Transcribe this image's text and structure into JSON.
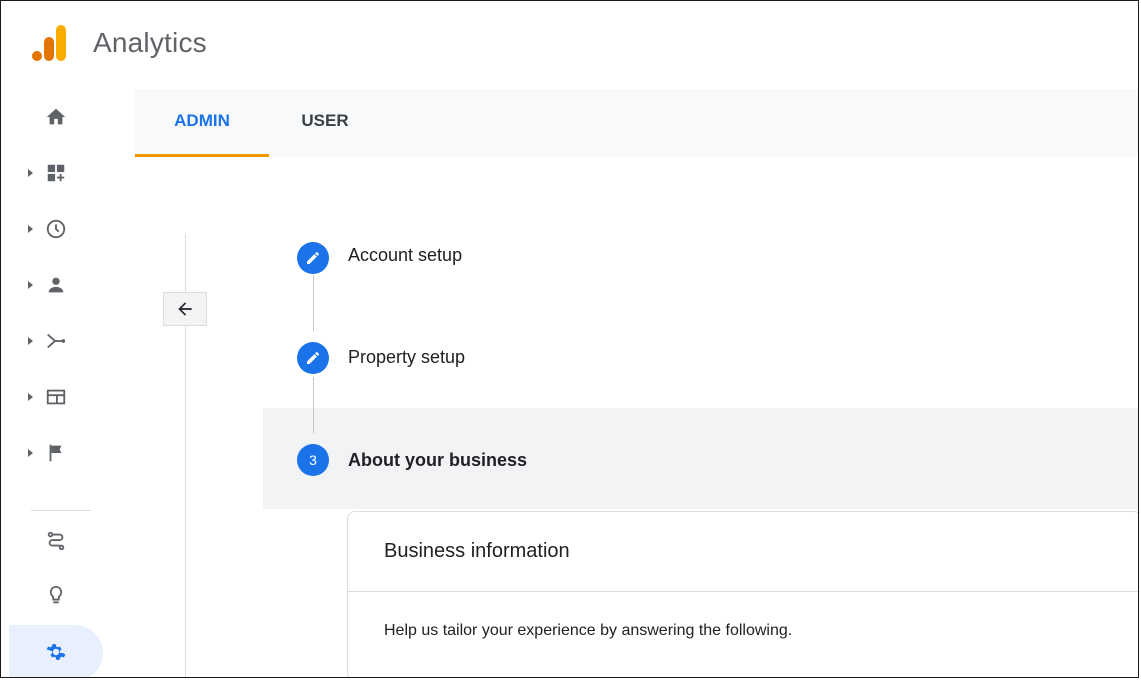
{
  "app": {
    "title": "Analytics"
  },
  "colors": {
    "accent": "#1a73e8",
    "tab_indicator": "#f29900",
    "logo_orange": "#f9ab00",
    "logo_dark_orange": "#e37400"
  },
  "rail": {
    "items": [
      {
        "icon": "home-icon"
      },
      {
        "icon": "customization-icon"
      },
      {
        "icon": "realtime-clock-icon"
      },
      {
        "icon": "audience-person-icon"
      },
      {
        "icon": "acquisition-icon"
      },
      {
        "icon": "behavior-icon"
      },
      {
        "icon": "conversions-flag-icon"
      },
      {
        "icon": "attribution-icon"
      },
      {
        "icon": "discover-lightbulb-icon"
      },
      {
        "icon": "admin-gear-icon"
      }
    ]
  },
  "tabs": [
    {
      "label": "ADMIN",
      "active": true
    },
    {
      "label": "USER",
      "active": false
    }
  ],
  "wizard": {
    "steps": [
      {
        "label": "Account setup",
        "state": "edit"
      },
      {
        "label": "Property setup",
        "state": "edit"
      },
      {
        "number": "3",
        "label": "About your business",
        "state": "current"
      }
    ],
    "card": {
      "title": "Business information",
      "help": "Help us tailor your experience by answering the following."
    }
  }
}
